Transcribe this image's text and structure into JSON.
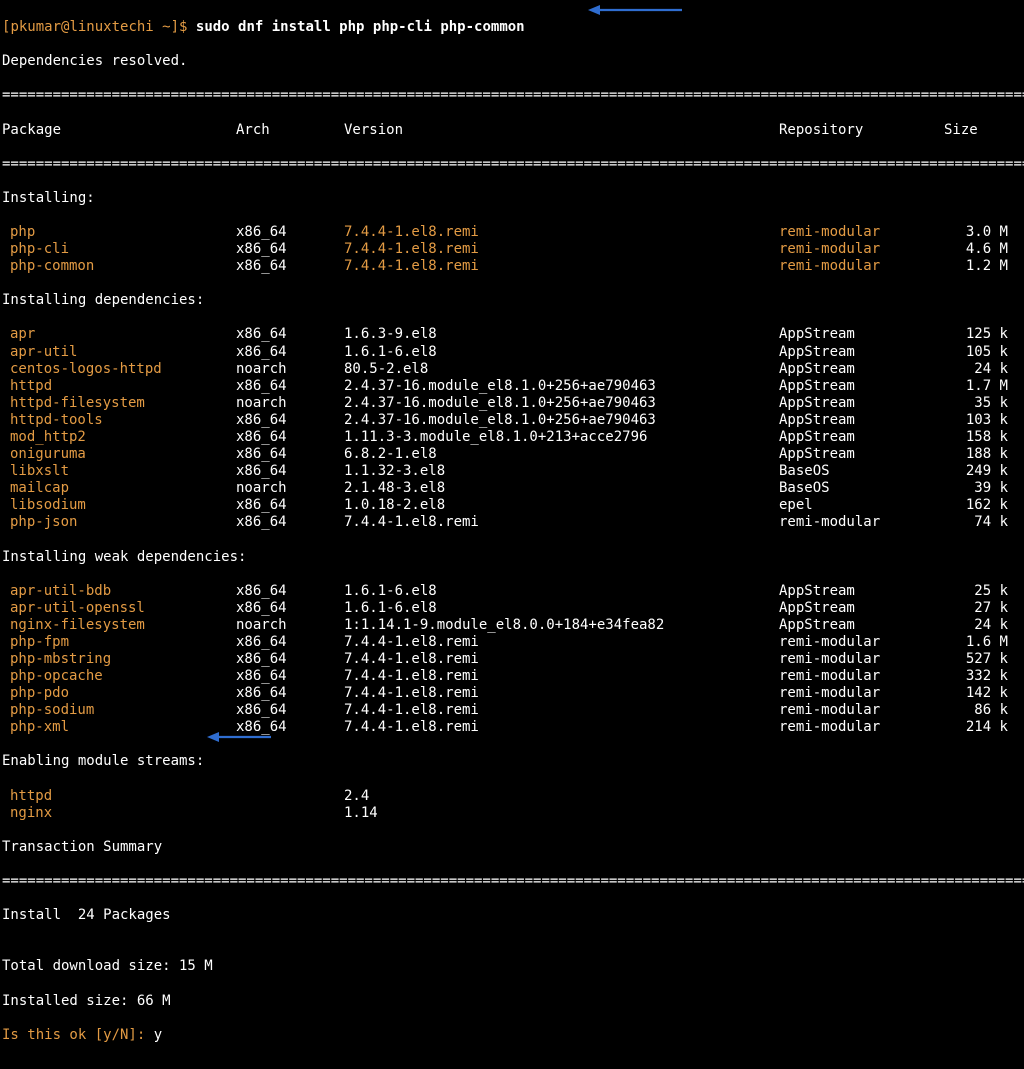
{
  "prompt": {
    "open": "[",
    "user_host": "pkumar@linuxtechi",
    "path": " ~]$ ",
    "cmd": "sudo dnf install php php-cli php-common"
  },
  "deps_resolved": "Dependencies resolved.",
  "rule": "===========================================================================================================================",
  "hdr": {
    "pkg": "Package",
    "arch": "Arch",
    "ver": "Version",
    "repo": "Repository",
    "size": "Size"
  },
  "sections": {
    "installing": "Installing:",
    "installing_deps": "Installing dependencies:",
    "installing_weak": "Installing weak dependencies:",
    "enabling": "Enabling module streams:"
  },
  "installing": [
    {
      "pkg": "php",
      "arch": "x86_64",
      "ver": "7.4.4-1.el8.remi",
      "repo": "remi-modular",
      "size": "3.0 M"
    },
    {
      "pkg": "php-cli",
      "arch": "x86_64",
      "ver": "7.4.4-1.el8.remi",
      "repo": "remi-modular",
      "size": "4.6 M"
    },
    {
      "pkg": "php-common",
      "arch": "x86_64",
      "ver": "7.4.4-1.el8.remi",
      "repo": "remi-modular",
      "size": "1.2 M"
    }
  ],
  "deps": [
    {
      "pkg": "apr",
      "arch": "x86_64",
      "ver": "1.6.3-9.el8",
      "repo": "AppStream",
      "size": "125 k"
    },
    {
      "pkg": "apr-util",
      "arch": "x86_64",
      "ver": "1.6.1-6.el8",
      "repo": "AppStream",
      "size": "105 k"
    },
    {
      "pkg": "centos-logos-httpd",
      "arch": "noarch",
      "ver": "80.5-2.el8",
      "repo": "AppStream",
      "size": "24 k"
    },
    {
      "pkg": "httpd",
      "arch": "x86_64",
      "ver": "2.4.37-16.module_el8.1.0+256+ae790463",
      "repo": "AppStream",
      "size": "1.7 M"
    },
    {
      "pkg": "httpd-filesystem",
      "arch": "noarch",
      "ver": "2.4.37-16.module_el8.1.0+256+ae790463",
      "repo": "AppStream",
      "size": "35 k"
    },
    {
      "pkg": "httpd-tools",
      "arch": "x86_64",
      "ver": "2.4.37-16.module_el8.1.0+256+ae790463",
      "repo": "AppStream",
      "size": "103 k"
    },
    {
      "pkg": "mod_http2",
      "arch": "x86_64",
      "ver": "1.11.3-3.module_el8.1.0+213+acce2796",
      "repo": "AppStream",
      "size": "158 k"
    },
    {
      "pkg": "oniguruma",
      "arch": "x86_64",
      "ver": "6.8.2-1.el8",
      "repo": "AppStream",
      "size": "188 k"
    },
    {
      "pkg": "libxslt",
      "arch": "x86_64",
      "ver": "1.1.32-3.el8",
      "repo": "BaseOS",
      "size": "249 k"
    },
    {
      "pkg": "mailcap",
      "arch": "noarch",
      "ver": "2.1.48-3.el8",
      "repo": "BaseOS",
      "size": "39 k"
    },
    {
      "pkg": "libsodium",
      "arch": "x86_64",
      "ver": "1.0.18-2.el8",
      "repo": "epel",
      "size": "162 k"
    },
    {
      "pkg": "php-json",
      "arch": "x86_64",
      "ver": "7.4.4-1.el8.remi",
      "repo": "remi-modular",
      "size": "74 k"
    }
  ],
  "weak": [
    {
      "pkg": "apr-util-bdb",
      "arch": "x86_64",
      "ver": "1.6.1-6.el8",
      "repo": "AppStream",
      "size": "25 k"
    },
    {
      "pkg": "apr-util-openssl",
      "arch": "x86_64",
      "ver": "1.6.1-6.el8",
      "repo": "AppStream",
      "size": "27 k"
    },
    {
      "pkg": "nginx-filesystem",
      "arch": "noarch",
      "ver": "1:1.14.1-9.module_el8.0.0+184+e34fea82",
      "repo": "AppStream",
      "size": "24 k"
    },
    {
      "pkg": "php-fpm",
      "arch": "x86_64",
      "ver": "7.4.4-1.el8.remi",
      "repo": "remi-modular",
      "size": "1.6 M"
    },
    {
      "pkg": "php-mbstring",
      "arch": "x86_64",
      "ver": "7.4.4-1.el8.remi",
      "repo": "remi-modular",
      "size": "527 k"
    },
    {
      "pkg": "php-opcache",
      "arch": "x86_64",
      "ver": "7.4.4-1.el8.remi",
      "repo": "remi-modular",
      "size": "332 k"
    },
    {
      "pkg": "php-pdo",
      "arch": "x86_64",
      "ver": "7.4.4-1.el8.remi",
      "repo": "remi-modular",
      "size": "142 k"
    },
    {
      "pkg": "php-sodium",
      "arch": "x86_64",
      "ver": "7.4.4-1.el8.remi",
      "repo": "remi-modular",
      "size": "86 k"
    },
    {
      "pkg": "php-xml",
      "arch": "x86_64",
      "ver": "7.4.4-1.el8.remi",
      "repo": "remi-modular",
      "size": "214 k"
    }
  ],
  "streams": [
    {
      "pkg": "httpd",
      "ver": "2.4"
    },
    {
      "pkg": "nginx",
      "ver": "1.14"
    }
  ],
  "tx_summary": "Transaction Summary",
  "install_count": "Install  24 Packages",
  "blank": "",
  "total_dl": "Total download size: 15 M",
  "installed_sz": "Installed size: 66 M",
  "confirm": {
    "q": "Is this ok [y/N]: ",
    "a": "y"
  }
}
